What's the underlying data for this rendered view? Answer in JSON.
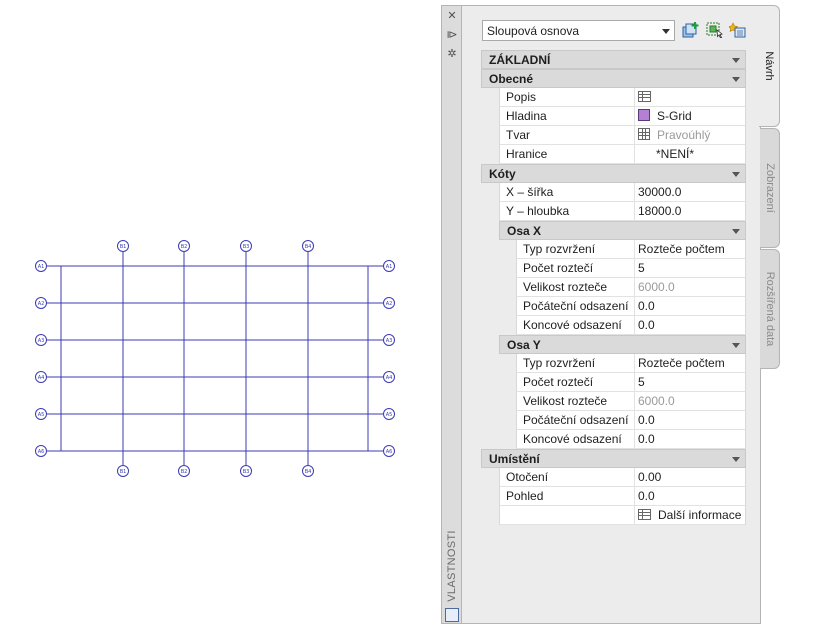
{
  "drawing": {
    "top_labels": [
      "B1",
      "B2",
      "B3",
      "B4"
    ],
    "bottom_labels": [
      "B1",
      "B2",
      "B3",
      "B4"
    ],
    "left_labels": [
      "A1",
      "A2",
      "A3",
      "A4",
      "A5",
      "A6"
    ],
    "right_labels": [
      "A1",
      "A2",
      "A3",
      "A4",
      "A5",
      "A6"
    ],
    "line_color": "#3b3bb5"
  },
  "palette": {
    "title": "VLASTNOSTI",
    "strip_buttons": {
      "close": "✕",
      "autohide": "⧐",
      "settings": "✲"
    },
    "tabs": {
      "design": "Návrh",
      "display": "Zobrazení",
      "extended": "Rozšířená data"
    },
    "object_selector": "Sloupová osnova",
    "tools": [
      "add-selected-icon",
      "quick-select-icon",
      "select-objects-icon"
    ]
  },
  "categories": {
    "basic": "ZÁKLADNÍ",
    "general": "Obecné",
    "dimensions": "Kóty",
    "axis_x": "Osa X",
    "axis_y": "Osa Y",
    "location": "Umístění"
  },
  "properties": {
    "description": {
      "name": "Popis",
      "value": ""
    },
    "layer": {
      "name": "Hladina",
      "value": "S-Grid",
      "color": "#b67fd6"
    },
    "shape": {
      "name": "Tvar",
      "value": "Pravoúhlý"
    },
    "boundary": {
      "name": "Hranice",
      "value": "*NENÍ*"
    },
    "x_width": {
      "name": "X – šířka",
      "value": "30000.0"
    },
    "y_depth": {
      "name": "Y – hloubka",
      "value": "18000.0"
    },
    "x_layout_type": {
      "name": "Typ rozvržení",
      "value": "Rozteče počtem"
    },
    "x_bay_count": {
      "name": "Počet roztečí",
      "value": "5"
    },
    "x_bay_size": {
      "name": "Velikost rozteče",
      "value": "6000.0"
    },
    "x_start_offset": {
      "name": "Počáteční odsazení",
      "value": "0.0"
    },
    "x_end_offset": {
      "name": "Koncové odsazení",
      "value": "0.0"
    },
    "y_layout_type": {
      "name": "Typ rozvržení",
      "value": "Rozteče počtem"
    },
    "y_bay_count": {
      "name": "Počet roztečí",
      "value": "5"
    },
    "y_bay_size": {
      "name": "Velikost rozteče",
      "value": "6000.0"
    },
    "y_start_offset": {
      "name": "Počáteční odsazení",
      "value": "0.0"
    },
    "y_end_offset": {
      "name": "Koncové odsazení",
      "value": "0.0"
    },
    "rotation": {
      "name": "Otočení",
      "value": "0.00"
    },
    "elevation": {
      "name": "Pohled",
      "value": "0.0"
    },
    "more_info": {
      "name": "",
      "value": "Další informace"
    }
  }
}
